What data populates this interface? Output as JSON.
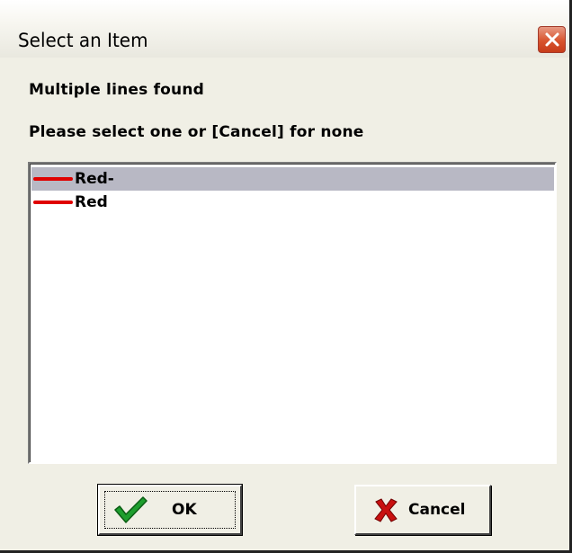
{
  "window": {
    "title": "Select an Item",
    "close_icon": "close-x-icon"
  },
  "messages": {
    "line1": "Multiple lines found",
    "line2": "Please select one or [Cancel] for none"
  },
  "list": {
    "items": [
      {
        "label": "Red-",
        "swatch_color": "#e00000",
        "selected": true
      },
      {
        "label": "Red",
        "swatch_color": "#e00000",
        "selected": false
      }
    ]
  },
  "buttons": {
    "ok_label": "OK",
    "ok_icon": "checkmark-icon",
    "cancel_label": "Cancel",
    "cancel_icon": "red-x-icon"
  },
  "colors": {
    "dialog_bg": "#f0efe5",
    "selection_bg": "#b8b8c4",
    "swatch_red": "#e00000",
    "close_button_red": "#d8542e"
  }
}
